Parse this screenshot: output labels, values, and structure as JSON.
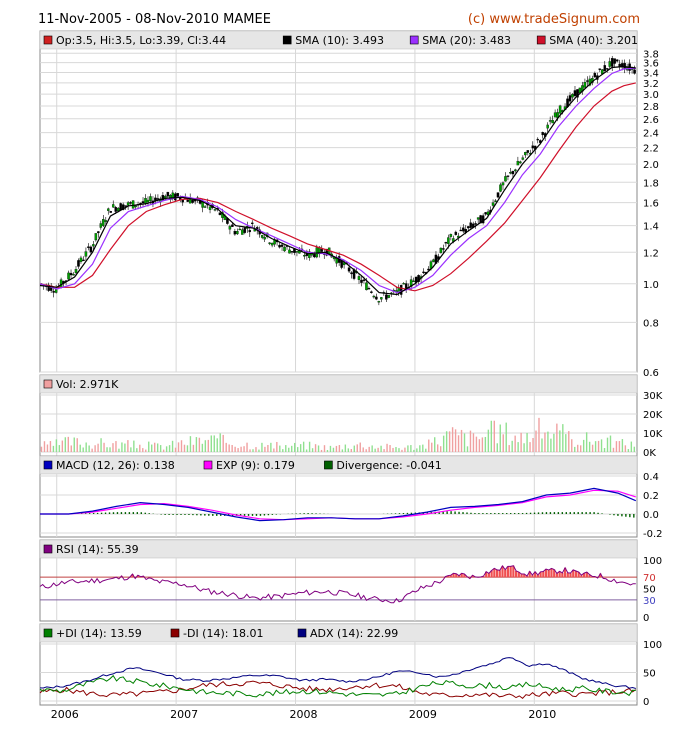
{
  "header": {
    "title": "11-Nov-2005 - 08-Nov-2010 MAMEE",
    "credit": "(c) www.tradeSignum.com"
  },
  "colors": {
    "price_up": "#00a000",
    "price_down": "#000000",
    "sma10": "#000000",
    "sma20": "#9b30ff",
    "sma40": "#d0102a",
    "vol_up": "#90e090",
    "vol_down": "#f0a0a0",
    "macd": "#0000c0",
    "exp": "#ff00ff",
    "divergence": "#006000",
    "rsi": "#800080",
    "rsi_fill": "#f05050",
    "plus_di": "#008000",
    "minus_di": "#8b0000",
    "adx": "#000080",
    "legend_bg": "#e6e6e6",
    "grid": "#d8d8d8"
  },
  "x_axis": {
    "labels": [
      "2006",
      "2007",
      "2008",
      "2009",
      "2010"
    ]
  },
  "chart_data": [
    {
      "type": "candlestick",
      "panel": "price",
      "legend": [
        {
          "label": "Op:3.5, Hi:3.5, Lo:3.39, Cl:3.44",
          "color": "#d02020"
        },
        {
          "label": "SMA (10): 3.493",
          "color": "#000000"
        },
        {
          "label": "SMA (20): 3.483",
          "color": "#9b30ff"
        },
        {
          "label": "SMA (40): 3.201",
          "color": "#d0102a"
        }
      ],
      "y_scale": "log",
      "ylim": [
        0.6,
        3.85
      ],
      "y_ticks": [
        "3.8",
        "3.6",
        "3.4",
        "3.2",
        "3.0",
        "2.8",
        "2.6",
        "2.4",
        "2.2",
        "2.0",
        "1.8",
        "1.6",
        "1.4",
        "1.2",
        "1.0",
        "0.8",
        "0.6"
      ],
      "time": [
        2005.86,
        2006.0,
        2006.15,
        2006.3,
        2006.45,
        2006.6,
        2006.75,
        2006.9,
        2007.05,
        2007.2,
        2007.35,
        2007.5,
        2007.65,
        2007.8,
        2007.95,
        2008.1,
        2008.25,
        2008.4,
        2008.55,
        2008.7,
        2008.85,
        2009.0,
        2009.15,
        2009.3,
        2009.45,
        2009.6,
        2009.75,
        2009.9,
        2010.05,
        2010.2,
        2010.35,
        2010.5,
        2010.65,
        2010.75,
        2010.85
      ],
      "close": [
        1.0,
        0.97,
        1.08,
        1.25,
        1.55,
        1.58,
        1.6,
        1.66,
        1.65,
        1.6,
        1.52,
        1.35,
        1.4,
        1.28,
        1.22,
        1.18,
        1.22,
        1.12,
        1.02,
        0.92,
        0.95,
        1.02,
        1.12,
        1.3,
        1.38,
        1.48,
        1.8,
        2.05,
        2.3,
        2.7,
        3.0,
        3.3,
        3.6,
        3.55,
        3.44
      ],
      "sma10": [
        0.99,
        0.98,
        1.04,
        1.2,
        1.48,
        1.57,
        1.59,
        1.64,
        1.65,
        1.62,
        1.54,
        1.4,
        1.38,
        1.3,
        1.24,
        1.19,
        1.2,
        1.14,
        1.05,
        0.95,
        0.94,
        1.0,
        1.1,
        1.26,
        1.36,
        1.46,
        1.72,
        2.0,
        2.25,
        2.62,
        2.95,
        3.25,
        3.5,
        3.52,
        3.49
      ],
      "sma20": [
        1.0,
        0.97,
        1.0,
        1.12,
        1.38,
        1.52,
        1.57,
        1.62,
        1.66,
        1.63,
        1.56,
        1.45,
        1.38,
        1.32,
        1.26,
        1.2,
        1.19,
        1.15,
        1.08,
        0.99,
        0.95,
        0.98,
        1.05,
        1.18,
        1.3,
        1.4,
        1.6,
        1.88,
        2.12,
        2.48,
        2.8,
        3.1,
        3.38,
        3.47,
        3.48
      ],
      "sma40": [
        1.0,
        0.98,
        0.98,
        1.05,
        1.22,
        1.4,
        1.52,
        1.58,
        1.63,
        1.64,
        1.6,
        1.52,
        1.45,
        1.38,
        1.32,
        1.26,
        1.22,
        1.18,
        1.12,
        1.05,
        0.98,
        0.96,
        0.99,
        1.06,
        1.16,
        1.28,
        1.42,
        1.62,
        1.85,
        2.15,
        2.48,
        2.8,
        3.05,
        3.15,
        3.2
      ]
    },
    {
      "type": "bar",
      "panel": "volume",
      "legend": [
        {
          "label": "Vol: 2.971K",
          "color": "#f0a0a0"
        }
      ],
      "ylim": [
        0,
        30000
      ],
      "y_ticks": [
        "30K",
        "20K",
        "10K",
        "0K"
      ],
      "time": [
        2005.9,
        2006.1,
        2006.3,
        2006.5,
        2006.7,
        2006.9,
        2007.1,
        2007.3,
        2007.5,
        2007.7,
        2007.9,
        2008.1,
        2008.3,
        2008.5,
        2008.7,
        2008.9,
        2009.1,
        2009.3,
        2009.5,
        2009.7,
        2009.9,
        2010.1,
        2010.3,
        2010.5,
        2010.7,
        2010.85
      ],
      "values": [
        5000,
        9000,
        8000,
        7000,
        6000,
        5000,
        9000,
        11000,
        8000,
        6000,
        5000,
        6000,
        4000,
        7000,
        5000,
        4000,
        6000,
        16000,
        12000,
        19000,
        13000,
        21000,
        12000,
        11000,
        8000,
        6000
      ]
    },
    {
      "type": "line",
      "panel": "macd",
      "legend": [
        {
          "label": "MACD (12, 26): 0.138",
          "color": "#0000c0"
        },
        {
          "label": "EXP (9): 0.179",
          "color": "#ff00ff"
        },
        {
          "label": "Divergence: -0.041",
          "color": "#006000"
        }
      ],
      "ylim": [
        -0.2,
        0.4
      ],
      "y_ticks": [
        "0.4",
        "0.2",
        "0.0",
        "-0.2"
      ],
      "time": [
        2005.86,
        2006.1,
        2006.3,
        2006.5,
        2006.7,
        2006.9,
        2007.1,
        2007.3,
        2007.5,
        2007.7,
        2007.9,
        2008.1,
        2008.3,
        2008.5,
        2008.7,
        2008.9,
        2009.1,
        2009.3,
        2009.5,
        2009.7,
        2009.9,
        2010.1,
        2010.3,
        2010.5,
        2010.7,
        2010.85
      ],
      "macd": [
        0.0,
        0.0,
        0.03,
        0.08,
        0.12,
        0.1,
        0.07,
        0.02,
        -0.03,
        -0.07,
        -0.06,
        -0.04,
        -0.04,
        -0.05,
        -0.05,
        -0.02,
        0.02,
        0.07,
        0.08,
        0.1,
        0.13,
        0.2,
        0.22,
        0.27,
        0.22,
        0.14
      ],
      "exp": [
        0.0,
        0.0,
        0.02,
        0.06,
        0.1,
        0.11,
        0.08,
        0.04,
        -0.01,
        -0.05,
        -0.06,
        -0.05,
        -0.04,
        -0.05,
        -0.05,
        -0.03,
        0.0,
        0.04,
        0.07,
        0.09,
        0.12,
        0.18,
        0.2,
        0.25,
        0.24,
        0.18
      ],
      "divergence": [
        0.0,
        0.0,
        0.01,
        0.02,
        0.02,
        -0.01,
        -0.01,
        -0.02,
        -0.02,
        -0.02,
        0.0,
        0.01,
        0.0,
        0.0,
        0.0,
        0.01,
        0.02,
        0.03,
        0.01,
        0.01,
        0.01,
        0.02,
        0.02,
        0.02,
        -0.02,
        -0.04
      ]
    },
    {
      "type": "line",
      "panel": "rsi",
      "legend": [
        {
          "label": "RSI (14): 55.39",
          "color": "#800080"
        }
      ],
      "ylim": [
        0,
        100
      ],
      "y_ticks": [
        "100",
        "70",
        "50",
        "30",
        "0"
      ],
      "levels": [
        70,
        30
      ],
      "time": [
        2005.86,
        2006.05,
        2006.25,
        2006.45,
        2006.65,
        2006.85,
        2007.05,
        2007.25,
        2007.45,
        2007.65,
        2007.85,
        2008.05,
        2008.25,
        2008.45,
        2008.65,
        2008.85,
        2009.05,
        2009.2,
        2009.35,
        2009.5,
        2009.65,
        2009.8,
        2009.95,
        2010.1,
        2010.25,
        2010.4,
        2010.55,
        2010.7,
        2010.85
      ],
      "values": [
        52,
        60,
        63,
        66,
        72,
        62,
        58,
        46,
        40,
        33,
        36,
        42,
        45,
        40,
        32,
        28,
        50,
        62,
        76,
        70,
        82,
        88,
        75,
        80,
        82,
        75,
        72,
        63,
        56
      ]
    },
    {
      "type": "line",
      "panel": "dmi",
      "legend": [
        {
          "label": "+DI (14): 13.59",
          "color": "#008000"
        },
        {
          "label": "-DI (14): 18.01",
          "color": "#8b0000"
        },
        {
          "label": "ADX (14): 22.99",
          "color": "#000080"
        }
      ],
      "ylim": [
        0,
        100
      ],
      "y_ticks": [
        "100",
        "50",
        "0"
      ],
      "time": [
        2005.86,
        2006.05,
        2006.25,
        2006.45,
        2006.65,
        2006.85,
        2007.05,
        2007.25,
        2007.45,
        2007.65,
        2007.85,
        2008.05,
        2008.25,
        2008.45,
        2008.65,
        2008.85,
        2009.05,
        2009.2,
        2009.35,
        2009.5,
        2009.65,
        2009.8,
        2009.95,
        2010.1,
        2010.25,
        2010.4,
        2010.55,
        2010.7,
        2010.85
      ],
      "plus_di": [
        20,
        18,
        30,
        40,
        35,
        28,
        22,
        15,
        14,
        12,
        14,
        18,
        16,
        12,
        10,
        12,
        25,
        32,
        30,
        26,
        28,
        22,
        30,
        24,
        20,
        22,
        18,
        16,
        14
      ],
      "minus_di": [
        15,
        20,
        14,
        10,
        12,
        15,
        20,
        28,
        30,
        32,
        28,
        22,
        20,
        24,
        28,
        26,
        14,
        10,
        10,
        12,
        10,
        8,
        10,
        12,
        14,
        12,
        14,
        16,
        18
      ],
      "adx": [
        22,
        26,
        35,
        48,
        58,
        50,
        38,
        36,
        40,
        45,
        44,
        36,
        38,
        34,
        40,
        52,
        50,
        42,
        48,
        58,
        66,
        78,
        62,
        66,
        54,
        40,
        32,
        26,
        23
      ]
    }
  ]
}
